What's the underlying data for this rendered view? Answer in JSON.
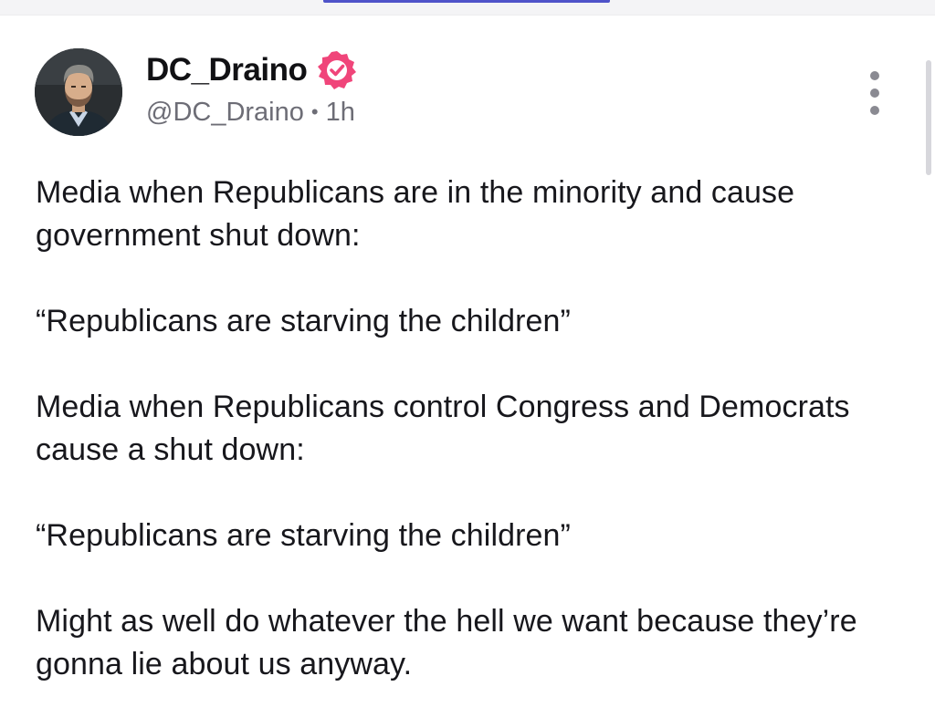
{
  "post": {
    "author": {
      "display_name": "DC_Draino",
      "handle": "@DC_Draino",
      "verified": true,
      "avatar": "profile-photo"
    },
    "separator": "•",
    "timestamp": "1h",
    "more_icon": "more-vertical-icon",
    "paragraphs": [
      "Media when Republicans are in the minority and cause government shut down:",
      "“Republicans are starving the children”",
      "Media when Republicans control Congress and Democrats cause a shut down:",
      "“Republicans are starving the children”",
      "Might as well do whatever the hell we want because they’re gonna lie about us anyway."
    ]
  },
  "colors": {
    "verified_badge": "#f0457a",
    "tab_accent": "#4f53c9",
    "text": "#17171c",
    "muted": "#6d6d76"
  }
}
